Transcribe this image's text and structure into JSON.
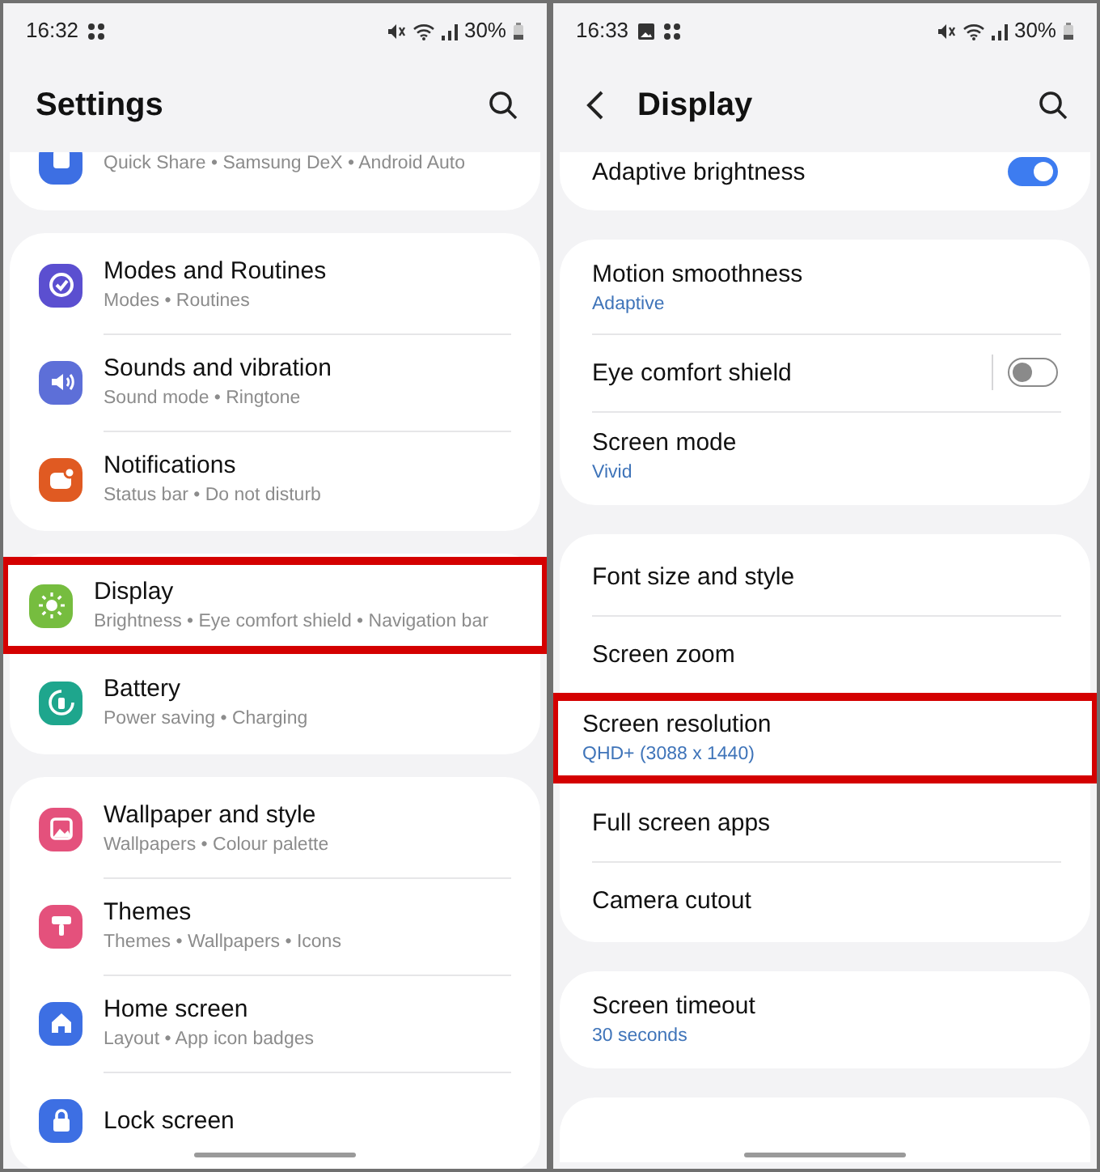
{
  "panels": [
    {
      "status_bar": {
        "time": "16:32",
        "battery": "30%"
      },
      "header": {
        "title": "Settings"
      },
      "groups": [
        {
          "clipped": true,
          "items": [
            {
              "kind": "nav",
              "color": "#3d6fe3",
              "subtitle": "Quick Share • Samsung DeX • Android Auto",
              "highlighted": false
            }
          ]
        },
        {
          "clipped": false,
          "items": [
            {
              "kind": "nav",
              "color": "#5b4fd0",
              "title": "Modes and Routines",
              "subtitle": "Modes • Routines",
              "highlighted": false
            },
            {
              "kind": "nav",
              "color": "#5d6fd8",
              "title": "Sounds and vibration",
              "subtitle": "Sound mode • Ringtone",
              "highlighted": false
            },
            {
              "kind": "nav",
              "color": "#e05a22",
              "title": "Notifications",
              "subtitle": "Status bar • Do not disturb",
              "highlighted": false
            }
          ]
        },
        {
          "clipped": false,
          "items": [
            {
              "kind": "nav",
              "color": "#76bd3f",
              "title": "Display",
              "subtitle": "Brightness • Eye comfort shield • Navigation bar",
              "highlighted": true
            },
            {
              "kind": "nav",
              "color": "#1ea68d",
              "title": "Battery",
              "subtitle": "Power saving • Charging",
              "highlighted": false
            }
          ]
        },
        {
          "clipped": false,
          "items": [
            {
              "kind": "nav",
              "color": "#e4517c",
              "title": "Wallpaper and style",
              "subtitle": "Wallpapers • Colour palette",
              "highlighted": false
            },
            {
              "kind": "nav",
              "color": "#e4517c",
              "title": "Themes",
              "subtitle": "Themes • Wallpapers • Icons",
              "highlighted": false
            },
            {
              "kind": "nav",
              "color": "#3d6fe3",
              "title": "Home screen",
              "subtitle": "Layout • App icon badges",
              "highlighted": false
            },
            {
              "kind": "nav",
              "color": "#3d6fe3",
              "title": "Lock screen",
              "highlighted": false
            }
          ]
        }
      ]
    },
    {
      "status_bar": {
        "time": "16:33",
        "battery": "30%"
      },
      "header": {
        "title": "Display"
      },
      "groups": [
        {
          "clipped": true,
          "items": [
            {
              "kind": "toggle",
              "title": "Adaptive brightness",
              "on": true,
              "split": false,
              "highlighted": false
            }
          ]
        },
        {
          "clipped": false,
          "items": [
            {
              "kind": "option",
              "title": "Motion smoothness",
              "value": "Adaptive",
              "highlighted": false
            },
            {
              "kind": "toggle",
              "title": "Eye comfort shield",
              "on": false,
              "split": true,
              "highlighted": false
            },
            {
              "kind": "option",
              "title": "Screen mode",
              "value": "Vivid",
              "highlighted": false
            }
          ]
        },
        {
          "clipped": false,
          "items": [
            {
              "kind": "option",
              "title": "Font size and style",
              "highlighted": false
            },
            {
              "kind": "option",
              "title": "Screen zoom",
              "highlighted": false
            },
            {
              "kind": "option",
              "title": "Screen resolution",
              "value": "QHD+ (3088 x 1440)",
              "highlighted": true
            },
            {
              "kind": "option",
              "title": "Full screen apps",
              "highlighted": false
            },
            {
              "kind": "option",
              "title": "Camera cutout",
              "highlighted": false
            }
          ]
        },
        {
          "clipped": false,
          "items": [
            {
              "kind": "option",
              "title": "Screen timeout",
              "value": "30 seconds",
              "highlighted": false
            }
          ]
        },
        {
          "clipped": true
        }
      ]
    }
  ]
}
